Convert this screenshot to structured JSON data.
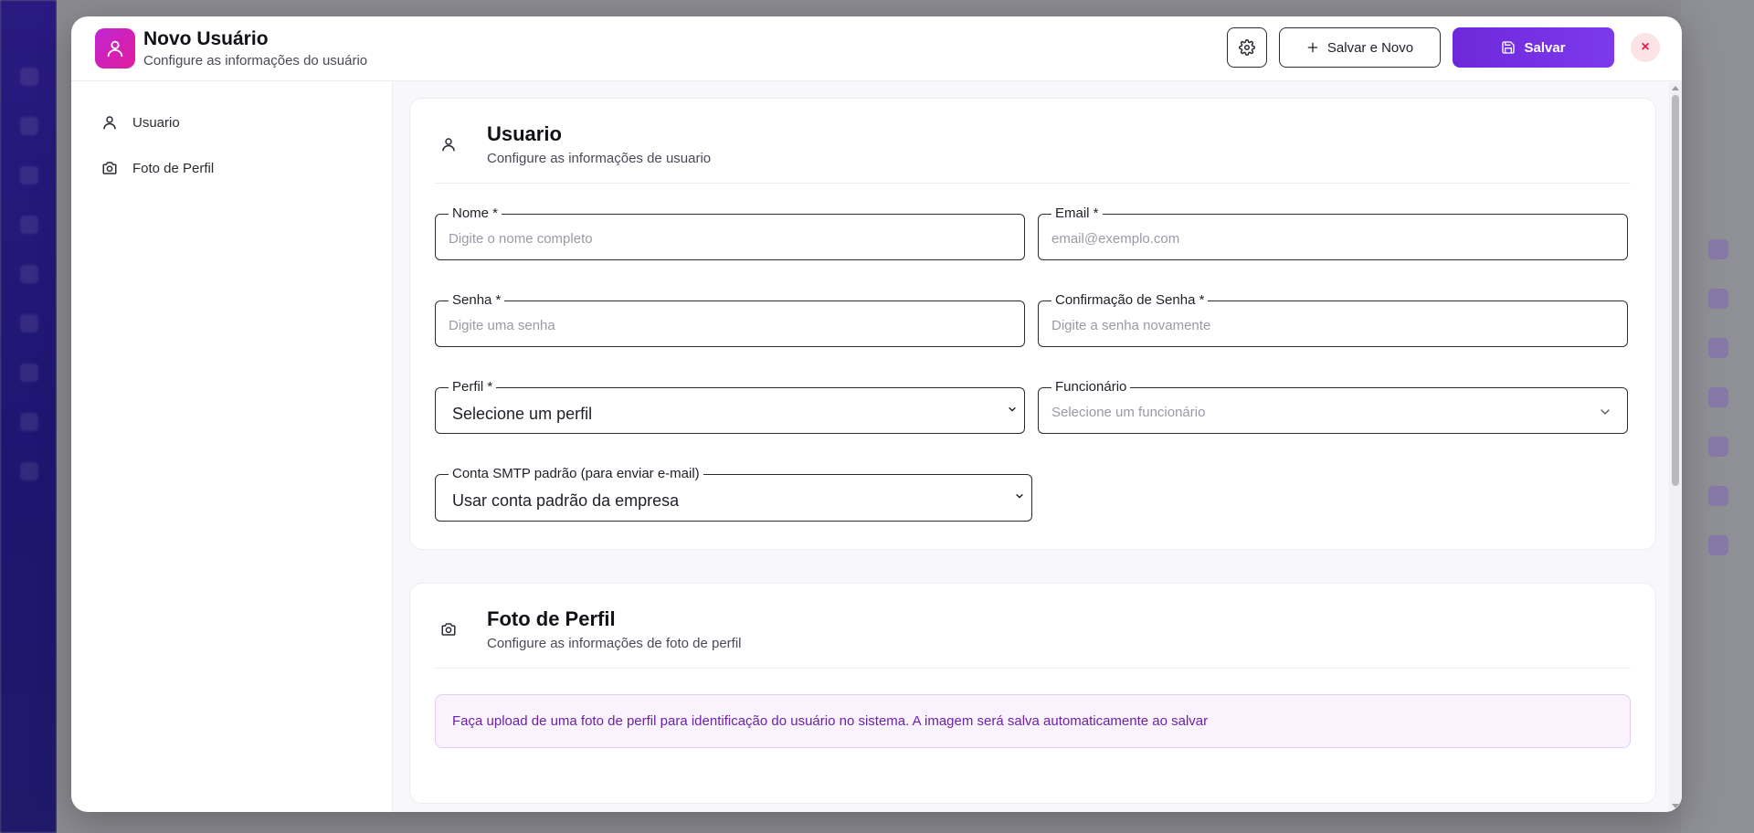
{
  "header": {
    "title": "Novo Usuário",
    "subtitle": "Configure as informações do usuário",
    "save_new_label": "Salvar e Novo",
    "save_label": "Salvar",
    "close_label": "×"
  },
  "sidebar": {
    "items": [
      {
        "label": "Usuario",
        "icon": "user-icon"
      },
      {
        "label": "Foto de Perfil",
        "icon": "camera-icon"
      }
    ]
  },
  "user_section": {
    "title": "Usuario",
    "subtitle": "Configure as informações de usuario",
    "fields": {
      "nome": {
        "label": "Nome *",
        "placeholder": "Digite o nome completo"
      },
      "email": {
        "label": "Email *",
        "placeholder": "email@exemplo.com"
      },
      "senha": {
        "label": "Senha *",
        "placeholder": "Digite uma senha"
      },
      "confirmacao": {
        "label": "Confirmação de Senha *",
        "placeholder": "Digite a senha novamente"
      },
      "perfil": {
        "label": "Perfil *",
        "value": "Selecione um perfil"
      },
      "funcionario": {
        "label": "Funcionário",
        "placeholder": "Selecione um funcionário"
      },
      "smtp": {
        "label": "Conta SMTP padrão (para enviar e-mail)",
        "value": "Usar conta padrão da empresa"
      }
    }
  },
  "photo_section": {
    "title": "Foto de Perfil",
    "subtitle": "Configure as informações de foto de perfil",
    "info": "Faça upload de uma foto de perfil para identificação do usuário no sistema. A imagem será salva automaticamente ao salvar"
  },
  "colors": {
    "primary": "#7c3aed",
    "accent_icon": "#d926c4",
    "close_bg": "#fde2e6",
    "info_text": "#6b21a8"
  }
}
